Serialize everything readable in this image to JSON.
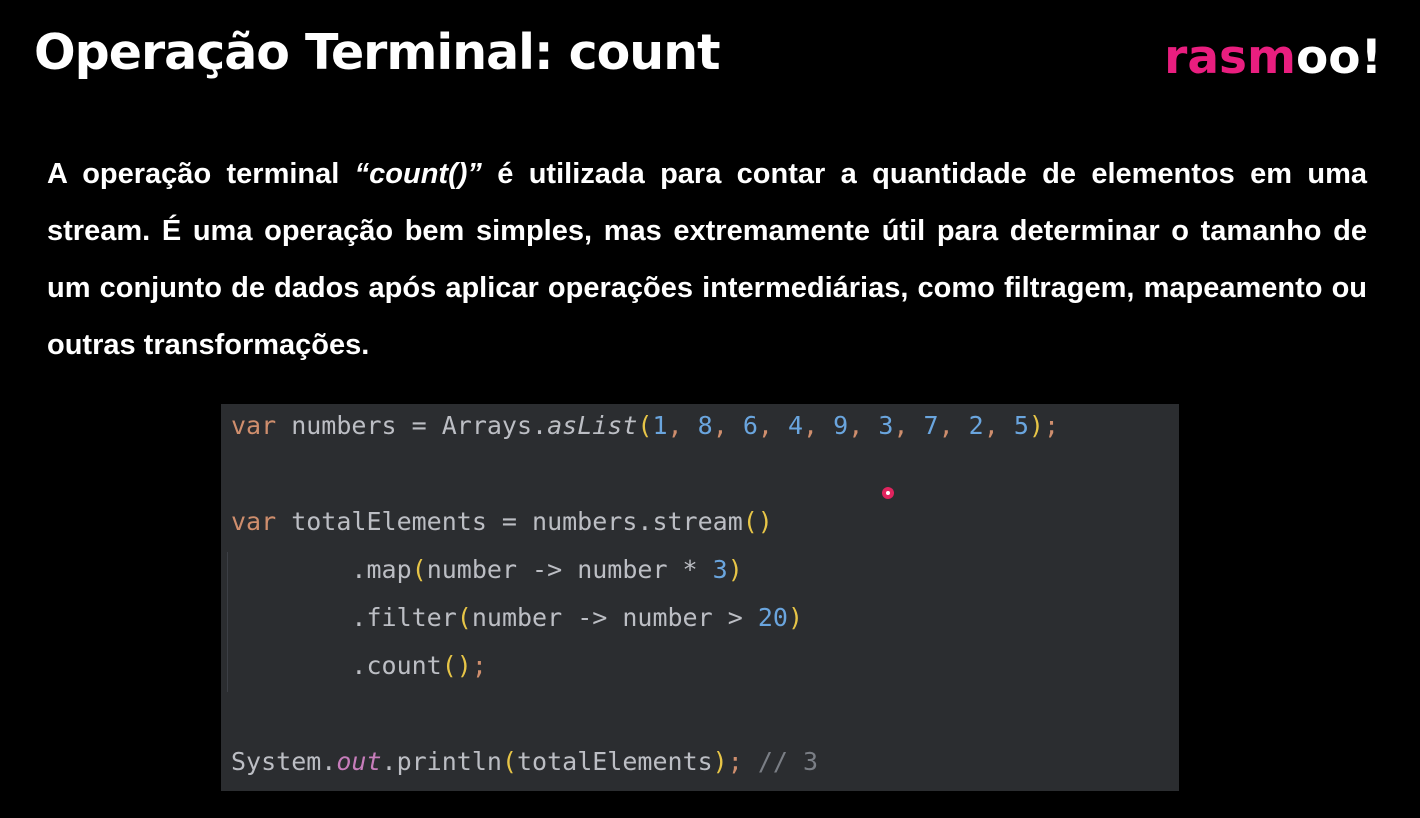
{
  "slide": {
    "title": "Operação Terminal: count",
    "logo": {
      "pink_part": "rasm",
      "white_part": "oo!",
      "pink_color": "#e91e7f"
    }
  },
  "description": {
    "before": "A operação terminal ",
    "emphasis": "“count()”",
    "after": " é utilizada para contar a quantidade de elementos em uma stream. É uma operação bem simples, mas extremamente útil para determinar o tamanho de um conjunto de dados após aplicar operações intermediárias, como filtragem, mapeamento ou outras transformações."
  },
  "code": {
    "lines": [
      [
        {
          "t": "var",
          "c": "kw"
        },
        {
          "t": " numbers = Arrays.",
          "c": "id"
        },
        {
          "t": "asList",
          "c": "fn-static"
        },
        {
          "t": "(",
          "c": "paren"
        },
        {
          "t": "1",
          "c": "num"
        },
        {
          "t": ", ",
          "c": "punct"
        },
        {
          "t": "8",
          "c": "num"
        },
        {
          "t": ", ",
          "c": "punct"
        },
        {
          "t": "6",
          "c": "num"
        },
        {
          "t": ", ",
          "c": "punct"
        },
        {
          "t": "4",
          "c": "num"
        },
        {
          "t": ", ",
          "c": "punct"
        },
        {
          "t": "9",
          "c": "num"
        },
        {
          "t": ", ",
          "c": "punct"
        },
        {
          "t": "3",
          "c": "num"
        },
        {
          "t": ", ",
          "c": "punct"
        },
        {
          "t": "7",
          "c": "num"
        },
        {
          "t": ", ",
          "c": "punct"
        },
        {
          "t": "2",
          "c": "num"
        },
        {
          "t": ", ",
          "c": "punct"
        },
        {
          "t": "5",
          "c": "num"
        },
        {
          "t": ")",
          "c": "paren"
        },
        {
          "t": ";",
          "c": "punct"
        }
      ],
      [],
      [
        {
          "t": "var",
          "c": "kw"
        },
        {
          "t": " totalElements = numbers.stream",
          "c": "id"
        },
        {
          "t": "()",
          "c": "paren"
        }
      ],
      [
        {
          "t": "        .map",
          "c": "id"
        },
        {
          "t": "(",
          "c": "paren"
        },
        {
          "t": "number -> number * ",
          "c": "id"
        },
        {
          "t": "3",
          "c": "num"
        },
        {
          "t": ")",
          "c": "paren"
        }
      ],
      [
        {
          "t": "        .filter",
          "c": "id"
        },
        {
          "t": "(",
          "c": "paren"
        },
        {
          "t": "number -> number > ",
          "c": "id"
        },
        {
          "t": "20",
          "c": "num"
        },
        {
          "t": ")",
          "c": "paren"
        }
      ],
      [
        {
          "t": "        .count",
          "c": "id"
        },
        {
          "t": "()",
          "c": "paren"
        },
        {
          "t": ";",
          "c": "punct"
        }
      ],
      [],
      [
        {
          "t": "System.",
          "c": "id"
        },
        {
          "t": "out",
          "c": "field"
        },
        {
          "t": ".println",
          "c": "id"
        },
        {
          "t": "(",
          "c": "paren"
        },
        {
          "t": "totalElements",
          "c": "id"
        },
        {
          "t": ")",
          "c": "paren"
        },
        {
          "t": ";",
          "c": "punct"
        },
        {
          "t": " // 3",
          "c": "cmt"
        }
      ]
    ]
  }
}
